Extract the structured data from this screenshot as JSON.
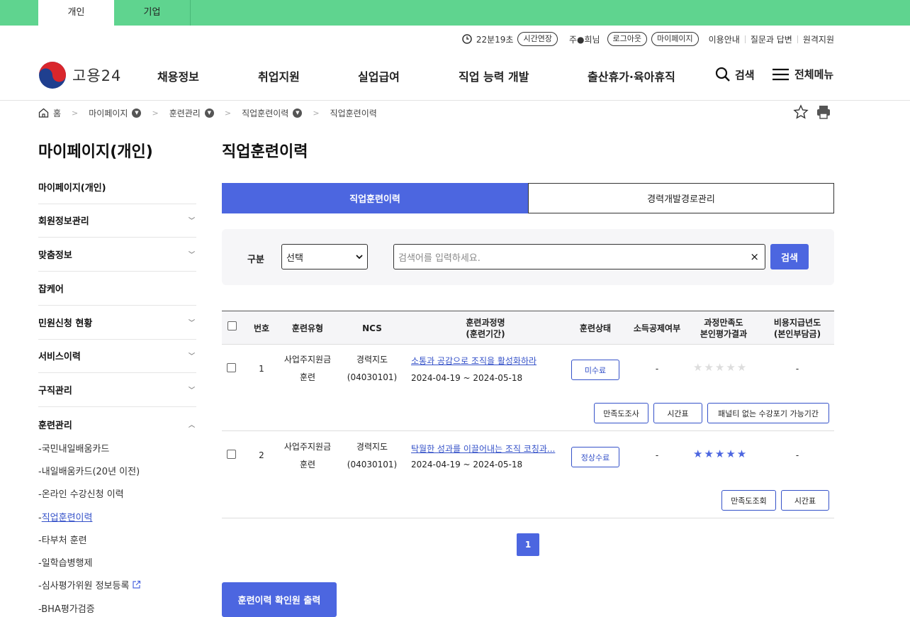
{
  "top_tabs": [
    "개인",
    "기업"
  ],
  "util": {
    "timer": "22분19초",
    "extend": "시간연장",
    "user": "주●희님",
    "logout": "로그아웃",
    "mypage": "마이페이지",
    "links": [
      "이용안내",
      "질문과 답변",
      "원격지원"
    ]
  },
  "logo": "고용24",
  "gnb": [
    "채용정보",
    "취업지원",
    "실업급여",
    "직업 능력 개발",
    "출산휴가·육아휴직"
  ],
  "header_search": "검색",
  "header_menu": "전체메뉴",
  "breadcrumb": [
    "홈",
    "마이페이지",
    "훈련관리",
    "직업훈련이력",
    "직업훈련이력"
  ],
  "lnb": {
    "title": "마이페이지(개인)",
    "items": [
      "마이페이지(개인)",
      "회원정보관리",
      "맞춤정보",
      "잡케어",
      "민원신청 현황",
      "서비스이력",
      "구직관리",
      "훈련관리"
    ],
    "subs": [
      "국민내일배움카드",
      "내일배움카드(20년 이전)",
      "온라인 수강신청 이력",
      "직업훈련이력",
      "타부처 훈련",
      "일학습병행제",
      "심사평가위원 정보등록",
      "BHA평가검증"
    ]
  },
  "page_title": "직업훈련이력",
  "content_tabs": [
    "직업훈련이력",
    "경력개발경로관리"
  ],
  "search": {
    "label": "구분",
    "select": "선택",
    "placeholder": "검색어를 입력하세요.",
    "button": "검색",
    "clear": "×"
  },
  "table": {
    "headers": [
      "번호",
      "훈련유형",
      "NCS",
      "훈련과정명\n(훈련기간)",
      "훈련상태",
      "소득공제여부",
      "과정만족도\n본인평가결과",
      "비용지급년도\n(본인부담금)"
    ],
    "rows": [
      {
        "no": "1",
        "type1": "사업주지원금",
        "type2": "훈련",
        "ncs1": "경력지도",
        "ncs2": "(04030101)",
        "course": "소통과 공감으로 조직을 활성화하라",
        "period": "2024-04-19 ~ 2024-05-18",
        "status": "미수료",
        "deduct": "-",
        "rating": 0,
        "pay": "-",
        "actions": [
          "만족도조사",
          "시간표",
          "패널티 없는 수강포기 가능기간"
        ]
      },
      {
        "no": "2",
        "type1": "사업주지원금",
        "type2": "훈련",
        "ncs1": "경력지도",
        "ncs2": "(04030101)",
        "course": "탁월한 성과를 이끌어내는 조직 코칭과...",
        "period": "2024-04-19 ~ 2024-05-18",
        "status": "정상수료",
        "deduct": "-",
        "rating": 5,
        "pay": "-",
        "actions": [
          "만족도조회",
          "시간표"
        ]
      }
    ]
  },
  "pagination": "1",
  "print_button": "훈련이력 확인원 출력",
  "colors": {
    "accent": "#4c66e0",
    "topbar": "#5fd48f",
    "link": "#3552c9"
  }
}
